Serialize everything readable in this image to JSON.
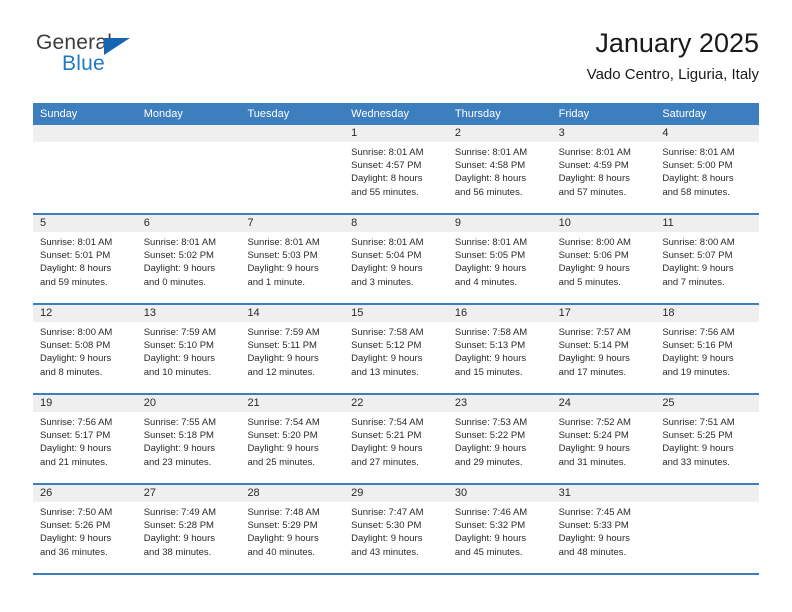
{
  "logo": {
    "word1": "General",
    "word2": "Blue",
    "triangle_color": "#1565b0",
    "word2_color": "#1f7bc4"
  },
  "header": {
    "title": "January 2025",
    "subtitle": "Vado Centro, Liguria, Italy"
  },
  "theme": {
    "header_bg": "#3d7ebf",
    "daynum_bg": "#efefef",
    "text": "#2a2a2a"
  },
  "calendar": {
    "weekday_headers": [
      "Sunday",
      "Monday",
      "Tuesday",
      "Wednesday",
      "Thursday",
      "Friday",
      "Saturday"
    ],
    "weeks": [
      [
        {
          "day": "",
          "lines": []
        },
        {
          "day": "",
          "lines": []
        },
        {
          "day": "",
          "lines": []
        },
        {
          "day": "1",
          "lines": [
            "Sunrise: 8:01 AM",
            "Sunset: 4:57 PM",
            "Daylight: 8 hours",
            "and 55 minutes."
          ]
        },
        {
          "day": "2",
          "lines": [
            "Sunrise: 8:01 AM",
            "Sunset: 4:58 PM",
            "Daylight: 8 hours",
            "and 56 minutes."
          ]
        },
        {
          "day": "3",
          "lines": [
            "Sunrise: 8:01 AM",
            "Sunset: 4:59 PM",
            "Daylight: 8 hours",
            "and 57 minutes."
          ]
        },
        {
          "day": "4",
          "lines": [
            "Sunrise: 8:01 AM",
            "Sunset: 5:00 PM",
            "Daylight: 8 hours",
            "and 58 minutes."
          ]
        }
      ],
      [
        {
          "day": "5",
          "lines": [
            "Sunrise: 8:01 AM",
            "Sunset: 5:01 PM",
            "Daylight: 8 hours",
            "and 59 minutes."
          ]
        },
        {
          "day": "6",
          "lines": [
            "Sunrise: 8:01 AM",
            "Sunset: 5:02 PM",
            "Daylight: 9 hours",
            "and 0 minutes."
          ]
        },
        {
          "day": "7",
          "lines": [
            "Sunrise: 8:01 AM",
            "Sunset: 5:03 PM",
            "Daylight: 9 hours",
            "and 1 minute."
          ]
        },
        {
          "day": "8",
          "lines": [
            "Sunrise: 8:01 AM",
            "Sunset: 5:04 PM",
            "Daylight: 9 hours",
            "and 3 minutes."
          ]
        },
        {
          "day": "9",
          "lines": [
            "Sunrise: 8:01 AM",
            "Sunset: 5:05 PM",
            "Daylight: 9 hours",
            "and 4 minutes."
          ]
        },
        {
          "day": "10",
          "lines": [
            "Sunrise: 8:00 AM",
            "Sunset: 5:06 PM",
            "Daylight: 9 hours",
            "and 5 minutes."
          ]
        },
        {
          "day": "11",
          "lines": [
            "Sunrise: 8:00 AM",
            "Sunset: 5:07 PM",
            "Daylight: 9 hours",
            "and 7 minutes."
          ]
        }
      ],
      [
        {
          "day": "12",
          "lines": [
            "Sunrise: 8:00 AM",
            "Sunset: 5:08 PM",
            "Daylight: 9 hours",
            "and 8 minutes."
          ]
        },
        {
          "day": "13",
          "lines": [
            "Sunrise: 7:59 AM",
            "Sunset: 5:10 PM",
            "Daylight: 9 hours",
            "and 10 minutes."
          ]
        },
        {
          "day": "14",
          "lines": [
            "Sunrise: 7:59 AM",
            "Sunset: 5:11 PM",
            "Daylight: 9 hours",
            "and 12 minutes."
          ]
        },
        {
          "day": "15",
          "lines": [
            "Sunrise: 7:58 AM",
            "Sunset: 5:12 PM",
            "Daylight: 9 hours",
            "and 13 minutes."
          ]
        },
        {
          "day": "16",
          "lines": [
            "Sunrise: 7:58 AM",
            "Sunset: 5:13 PM",
            "Daylight: 9 hours",
            "and 15 minutes."
          ]
        },
        {
          "day": "17",
          "lines": [
            "Sunrise: 7:57 AM",
            "Sunset: 5:14 PM",
            "Daylight: 9 hours",
            "and 17 minutes."
          ]
        },
        {
          "day": "18",
          "lines": [
            "Sunrise: 7:56 AM",
            "Sunset: 5:16 PM",
            "Daylight: 9 hours",
            "and 19 minutes."
          ]
        }
      ],
      [
        {
          "day": "19",
          "lines": [
            "Sunrise: 7:56 AM",
            "Sunset: 5:17 PM",
            "Daylight: 9 hours",
            "and 21 minutes."
          ]
        },
        {
          "day": "20",
          "lines": [
            "Sunrise: 7:55 AM",
            "Sunset: 5:18 PM",
            "Daylight: 9 hours",
            "and 23 minutes."
          ]
        },
        {
          "day": "21",
          "lines": [
            "Sunrise: 7:54 AM",
            "Sunset: 5:20 PM",
            "Daylight: 9 hours",
            "and 25 minutes."
          ]
        },
        {
          "day": "22",
          "lines": [
            "Sunrise: 7:54 AM",
            "Sunset: 5:21 PM",
            "Daylight: 9 hours",
            "and 27 minutes."
          ]
        },
        {
          "day": "23",
          "lines": [
            "Sunrise: 7:53 AM",
            "Sunset: 5:22 PM",
            "Daylight: 9 hours",
            "and 29 minutes."
          ]
        },
        {
          "day": "24",
          "lines": [
            "Sunrise: 7:52 AM",
            "Sunset: 5:24 PM",
            "Daylight: 9 hours",
            "and 31 minutes."
          ]
        },
        {
          "day": "25",
          "lines": [
            "Sunrise: 7:51 AM",
            "Sunset: 5:25 PM",
            "Daylight: 9 hours",
            "and 33 minutes."
          ]
        }
      ],
      [
        {
          "day": "26",
          "lines": [
            "Sunrise: 7:50 AM",
            "Sunset: 5:26 PM",
            "Daylight: 9 hours",
            "and 36 minutes."
          ]
        },
        {
          "day": "27",
          "lines": [
            "Sunrise: 7:49 AM",
            "Sunset: 5:28 PM",
            "Daylight: 9 hours",
            "and 38 minutes."
          ]
        },
        {
          "day": "28",
          "lines": [
            "Sunrise: 7:48 AM",
            "Sunset: 5:29 PM",
            "Daylight: 9 hours",
            "and 40 minutes."
          ]
        },
        {
          "day": "29",
          "lines": [
            "Sunrise: 7:47 AM",
            "Sunset: 5:30 PM",
            "Daylight: 9 hours",
            "and 43 minutes."
          ]
        },
        {
          "day": "30",
          "lines": [
            "Sunrise: 7:46 AM",
            "Sunset: 5:32 PM",
            "Daylight: 9 hours",
            "and 45 minutes."
          ]
        },
        {
          "day": "31",
          "lines": [
            "Sunrise: 7:45 AM",
            "Sunset: 5:33 PM",
            "Daylight: 9 hours",
            "and 48 minutes."
          ]
        },
        {
          "day": "",
          "lines": []
        }
      ]
    ]
  }
}
